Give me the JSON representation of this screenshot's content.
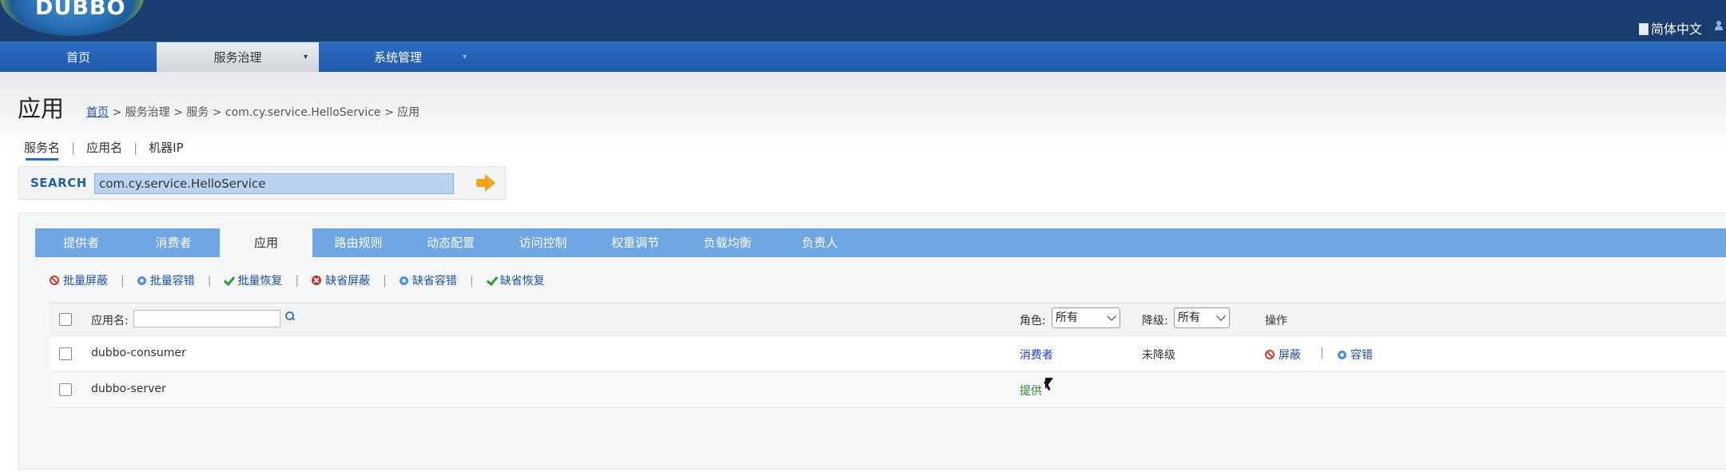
{
  "header": {
    "logo_text": "DUBBO",
    "language": "简体中文"
  },
  "nav": {
    "items": [
      {
        "label": "首页"
      },
      {
        "label": "服务治理"
      },
      {
        "label": "系统管理"
      }
    ],
    "caret": "▾",
    "caret2": "▾"
  },
  "page": {
    "title": "应用",
    "breadcrumb": {
      "home": "首页",
      "rest": " > 服务治理 > 服务 > com.cy.service.HelloService > 应用"
    }
  },
  "search": {
    "tabs": [
      "服务名",
      "应用名",
      "机器IP"
    ],
    "label": "SEARCH",
    "value": "com.cy.service.HelloService"
  },
  "tabs": [
    "提供者",
    "消费者",
    "应用",
    "路由规则",
    "动态配置",
    "访问控制",
    "权重调节",
    "负载均衡",
    "负责人"
  ],
  "actions": {
    "batch_disable": "批量屏蔽",
    "batch_tolerance": "批量容错",
    "batch_recover": "批量恢复",
    "default_disable": "缺省屏蔽",
    "default_tolerance": "缺省容错",
    "default_recover": "缺省恢复",
    "sep": "|"
  },
  "table": {
    "headers": {
      "app_name": "应用名:",
      "role": "角色:",
      "role_value": "所有",
      "degrade": "降级:",
      "degrade_value": "所有",
      "ops": "操作"
    },
    "rows": [
      {
        "name": "dubbo-consumer",
        "role": "消费者",
        "degrade": "未降级",
        "op_disable": "屏蔽",
        "op_tolerance": "容错"
      },
      {
        "name": "dubbo-server",
        "role": "提供"
      }
    ]
  }
}
